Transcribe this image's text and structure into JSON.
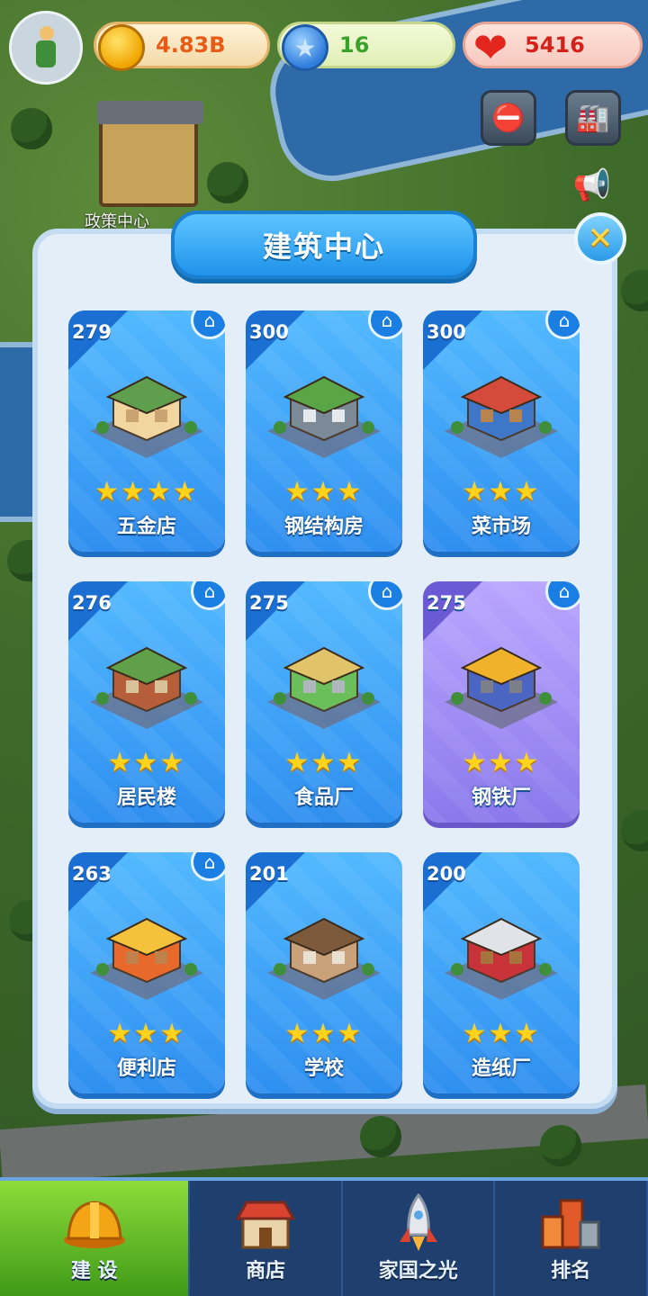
{
  "hud": {
    "coins": "4.83B",
    "stars": "16",
    "hearts": "5416"
  },
  "map": {
    "label": "政策中心"
  },
  "panel": {
    "title": "建筑中心",
    "buildings": [
      {
        "level": "279",
        "name": "五金店",
        "stars": 4,
        "home_badge": true,
        "style": "blue"
      },
      {
        "level": "300",
        "name": "钢结构房",
        "stars": 3,
        "home_badge": true,
        "style": "blue"
      },
      {
        "level": "300",
        "name": "菜市场",
        "stars": 3,
        "home_badge": true,
        "style": "blue"
      },
      {
        "level": "276",
        "name": "居民楼",
        "stars": 3,
        "home_badge": true,
        "style": "blue"
      },
      {
        "level": "275",
        "name": "食品厂",
        "stars": 3,
        "home_badge": true,
        "style": "blue"
      },
      {
        "level": "275",
        "name": "钢铁厂",
        "stars": 3,
        "home_badge": true,
        "style": "purple"
      },
      {
        "level": "263",
        "name": "便利店",
        "stars": 3,
        "home_badge": true,
        "style": "blue"
      },
      {
        "level": "201",
        "name": "学校",
        "stars": 3,
        "home_badge": false,
        "style": "blue"
      },
      {
        "level": "200",
        "name": "造纸厂",
        "stars": 3,
        "home_badge": false,
        "style": "blue"
      }
    ]
  },
  "nav": {
    "build": "建 设",
    "shop": "商店",
    "glory": "家国之光",
    "rank": "排名"
  },
  "colors": {
    "card_blue": "#3fa4f8",
    "card_purple": "#9d8bf4",
    "nav_active": "#6cc22a",
    "nav_bg": "#1f3f6e"
  }
}
